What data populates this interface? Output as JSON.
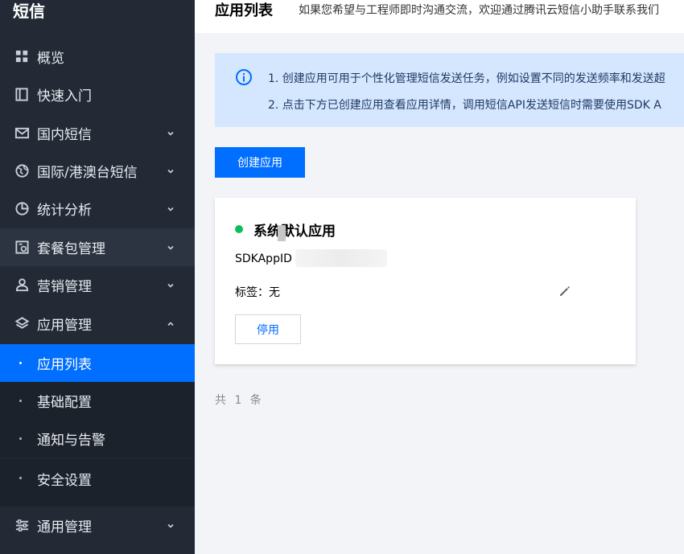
{
  "sidebar": {
    "brand": "短信",
    "items": [
      {
        "label": "概览",
        "icon": "grid-icon"
      },
      {
        "label": "快速入门",
        "icon": "book-icon"
      },
      {
        "label": "国内短信",
        "icon": "mail-icon"
      },
      {
        "label": "国际/港澳台短信",
        "icon": "globe-icon"
      },
      {
        "label": "统计分析",
        "icon": "pie-chart-icon"
      },
      {
        "label": "套餐包管理",
        "icon": "package-icon"
      },
      {
        "label": "营销管理",
        "icon": "users-icon"
      },
      {
        "label": "应用管理",
        "icon": "layers-icon"
      }
    ],
    "sub_items": [
      {
        "label": "应用列表"
      },
      {
        "label": "基础配置"
      },
      {
        "label": "通知与告警"
      },
      {
        "label": "安全设置"
      }
    ],
    "bottom_item": {
      "label": "通用管理",
      "icon": "sliders-icon"
    }
  },
  "header": {
    "title": "应用列表",
    "hint": "如果您希望与工程师即时沟通交流，欢迎通过腾讯云短信小助手联系我们"
  },
  "banner": {
    "line1": "1. 创建应用可用于个性化管理短信发送任务，例如设置不同的发送频率和发送超",
    "line2": "2. 点击下方已创建应用查看应用详情，调用短信API发送短信时需要使用SDK A"
  },
  "create_button": "创建应用",
  "app_card": {
    "name": "系统默认应用",
    "sdk_label": "SDKAppID",
    "tag_label": "标签：无",
    "disable_button": "停用",
    "status_color": "#0abf5b"
  },
  "total": "共 1 条",
  "colors": {
    "accent": "#006eff",
    "sidebar_bg": "#232a36",
    "banner_bg": "#d5e7ff"
  }
}
